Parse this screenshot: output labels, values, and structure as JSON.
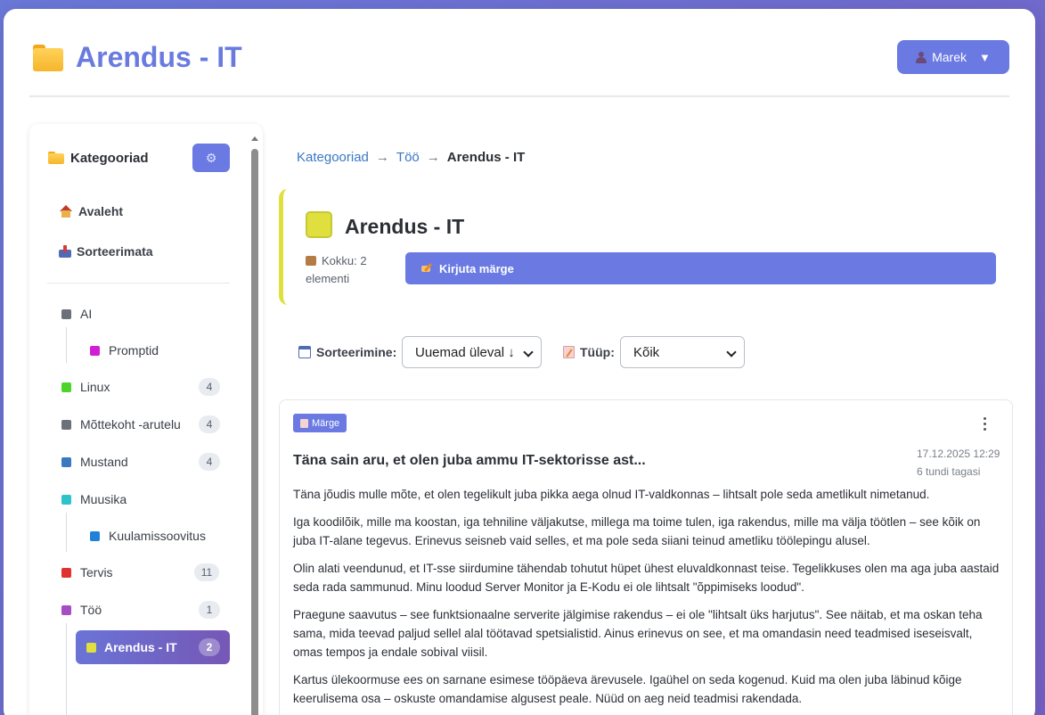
{
  "header": {
    "title": "Arendus - IT",
    "user": "Marek",
    "user_caret": "▼"
  },
  "sidebar": {
    "title": "Kategooriad",
    "gear": "⚙",
    "nav": [
      {
        "label": "Avaleht",
        "icon": "house-icon"
      },
      {
        "label": "Sorteerimata",
        "icon": "inbox-icon"
      }
    ],
    "categories": [
      {
        "label": "AI",
        "color": "#6b7079",
        "count": null
      },
      {
        "label": "Promptid",
        "color": "#d11fd8",
        "count": null,
        "child": true
      },
      {
        "label": "Linux",
        "color": "#4cd42a",
        "count": "4"
      },
      {
        "label": "Mõttekoht -arutelu",
        "color": "#6b7079",
        "count": "4"
      },
      {
        "label": "Mustand",
        "color": "#3b78c3",
        "count": "4"
      },
      {
        "label": "Muusika",
        "color": "#2ec3c9",
        "count": null
      },
      {
        "label": "Kuulamissoovitus",
        "color": "#2180d8",
        "count": null,
        "child": true
      },
      {
        "label": "Tervis",
        "color": "#e0302f",
        "count": "11"
      },
      {
        "label": "Töö",
        "color": "#a64dc4",
        "count": "1"
      }
    ],
    "active": {
      "label": "Arendus - IT",
      "color": "#dfe03e",
      "count": "2"
    }
  },
  "breadcrumb": {
    "items": [
      "Kategooriad",
      "Töö"
    ],
    "current": "Arendus - IT",
    "separator": "→"
  },
  "category_header": {
    "title": "Arendus - IT",
    "color": "#dfe03e",
    "total": "Kokku: 2 elementi",
    "write_button": "Kirjuta märge"
  },
  "filters": {
    "sort_label": "Sorteerimine:",
    "sort_value": "Uuemad üleval ↓",
    "type_label": "Tüüp:",
    "type_value": "Kõik"
  },
  "note": {
    "tag": "Märge",
    "date": "17.12.2025 12:29",
    "relative": "6 tundi tagasi",
    "title": "Täna sain aru, et olen juba ammu IT-sektorisse ast...",
    "paragraphs": [
      "Täna jõudis mulle mõte, et olen tegelikult juba pikka aega olnud IT-valdkonnas – lihtsalt pole seda ametlikult nimetanud.",
      "Iga koodilõik, mille ma koostan, iga tehniline väljakutse, millega ma toime tulen, iga rakendus, mille ma välja töötlen – see kõik on juba IT-alane tegevus. Erinevus seisneb vaid selles, et ma pole seda siiani teinud ametliku töölepingu alusel.",
      "Olin alati veendunud, et IT-sse siirdumine tähendab tohutut hüpet ühest eluvaldkonnast teise. Tegelikkuses olen ma aga juba aastaid seda rada sammunud. Minu loodud Server Monitor ja E-Kodu ei ole lihtsalt \"õppimiseks loodud\".",
      "Praegune saavutus – see funktsionaalne serverite jälgimise rakendus – ei ole \"lihtsalt üks harjutus\". See näitab, et ma oskan teha sama, mida teevad paljud sellel alal töötavad spetsialistid. Ainus erinevus on see, et ma omandasin need teadmised iseseisvalt, omas tempos ja endale sobival viisil.",
      "Kartus ülekoormuse ees on sarnane esimese tööpäeva ärevusele. Igaühel on seda kogenud. Kuid ma olen juba läbinud kõige keerulisema osa – oskuste omandamise algusest peale. Nüüd on aeg neid teadmisi rakendada."
    ]
  }
}
